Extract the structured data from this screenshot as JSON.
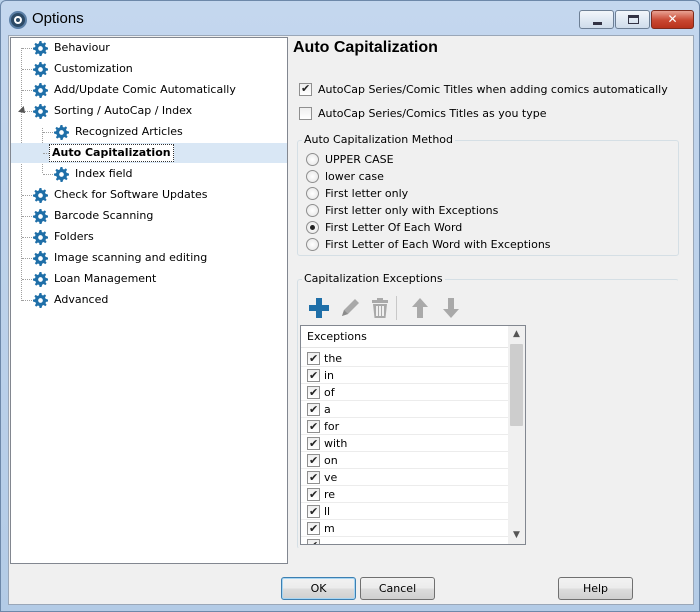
{
  "window": {
    "title": "Options",
    "minimize_label": "",
    "maximize_label": "",
    "close_label": "✕"
  },
  "tree": {
    "items": [
      {
        "label": "Behaviour",
        "level": 0,
        "icon": "gear-icon"
      },
      {
        "label": "Customization",
        "level": 0,
        "icon": "gear-icon"
      },
      {
        "label": "Add/Update Comic Automatically",
        "level": 0,
        "icon": "gear-icon"
      },
      {
        "label": "Sorting / AutoCap / Index",
        "level": 0,
        "icon": "gear-icon",
        "expanded": true
      },
      {
        "label": "Recognized Articles",
        "level": 1,
        "icon": "gear-icon"
      },
      {
        "label": "Auto Capitalization",
        "level": 1,
        "icon": "wrench-icon",
        "selected": true
      },
      {
        "label": "Index field",
        "level": 1,
        "icon": "gear-icon"
      },
      {
        "label": "Check for Software Updates",
        "level": 0,
        "icon": "gear-icon"
      },
      {
        "label": "Barcode Scanning",
        "level": 0,
        "icon": "gear-icon"
      },
      {
        "label": "Folders",
        "level": 0,
        "icon": "gear-icon"
      },
      {
        "label": "Image scanning and editing",
        "level": 0,
        "icon": "gear-icon"
      },
      {
        "label": "Loan Management",
        "level": 0,
        "icon": "gear-icon"
      },
      {
        "label": "Advanced",
        "level": 0,
        "icon": "gear-icon"
      }
    ]
  },
  "panel": {
    "title": "Auto Capitalization",
    "options": [
      {
        "label": "AutoCap Series/Comic Titles when adding comics automatically",
        "checked": true
      },
      {
        "label": "AutoCap Series/Comics Titles as you type",
        "checked": false
      }
    ],
    "method": {
      "title": "Auto Capitalization Method",
      "choices": [
        {
          "label": "UPPER CASE",
          "checked": false
        },
        {
          "label": "lower case",
          "checked": false
        },
        {
          "label": "First letter only",
          "checked": false
        },
        {
          "label": "First letter only with Exceptions",
          "checked": false
        },
        {
          "label": "First Letter Of Each Word",
          "checked": true
        },
        {
          "label": "First Letter of Each Word with Exceptions",
          "checked": false
        }
      ]
    },
    "exceptions": {
      "title": "Capitalization Exceptions",
      "column_header": "Exceptions",
      "rows": [
        {
          "word": "the",
          "checked": true
        },
        {
          "word": "in",
          "checked": true
        },
        {
          "word": "of",
          "checked": true
        },
        {
          "word": "a",
          "checked": true
        },
        {
          "word": "for",
          "checked": true
        },
        {
          "word": "with",
          "checked": true
        },
        {
          "word": "on",
          "checked": true
        },
        {
          "word": "ve",
          "checked": true
        },
        {
          "word": "re",
          "checked": true
        },
        {
          "word": "ll",
          "checked": true
        },
        {
          "word": "m",
          "checked": true
        }
      ]
    },
    "toolbar_icons": [
      "add-icon",
      "edit-icon",
      "delete-icon",
      "move-up-icon",
      "move-down-icon"
    ]
  },
  "buttons": {
    "ok": "OK",
    "cancel": "Cancel",
    "help": "Help"
  },
  "colors": {
    "accent_blue": "#1f6fa8",
    "selection": "#d9e7f5",
    "toolbar_gray": "#a9a9a9"
  }
}
